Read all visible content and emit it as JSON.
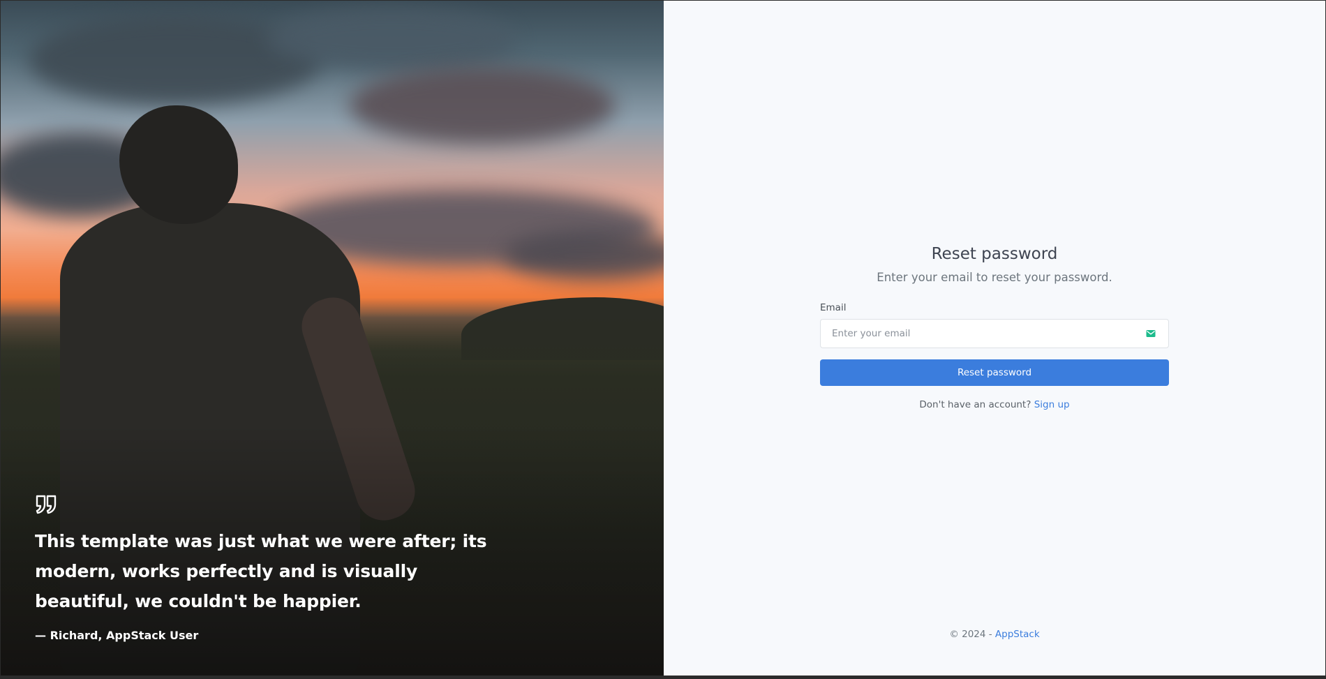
{
  "hero": {
    "quote_icon": "quote-icon",
    "quote_text": "This template was just what we were after; its modern, works perfectly and is visually beautiful, we couldn't be happier.",
    "author": "— Richard, AppStack User"
  },
  "form": {
    "title": "Reset password",
    "subtitle": "Enter your email to reset your password.",
    "email_label": "Email",
    "email_placeholder": "Enter your email",
    "email_value": "",
    "email_icon": "envelope-icon",
    "submit_label": "Reset password",
    "signup_prompt": "Don't have an account?",
    "signup_link": "Sign up"
  },
  "footer": {
    "copyright": "© 2024 -",
    "brand": "AppStack"
  },
  "colors": {
    "primary": "#3b7ddd",
    "icon_accent": "#1cbb8c",
    "panel_bg": "#f7f9fc"
  }
}
